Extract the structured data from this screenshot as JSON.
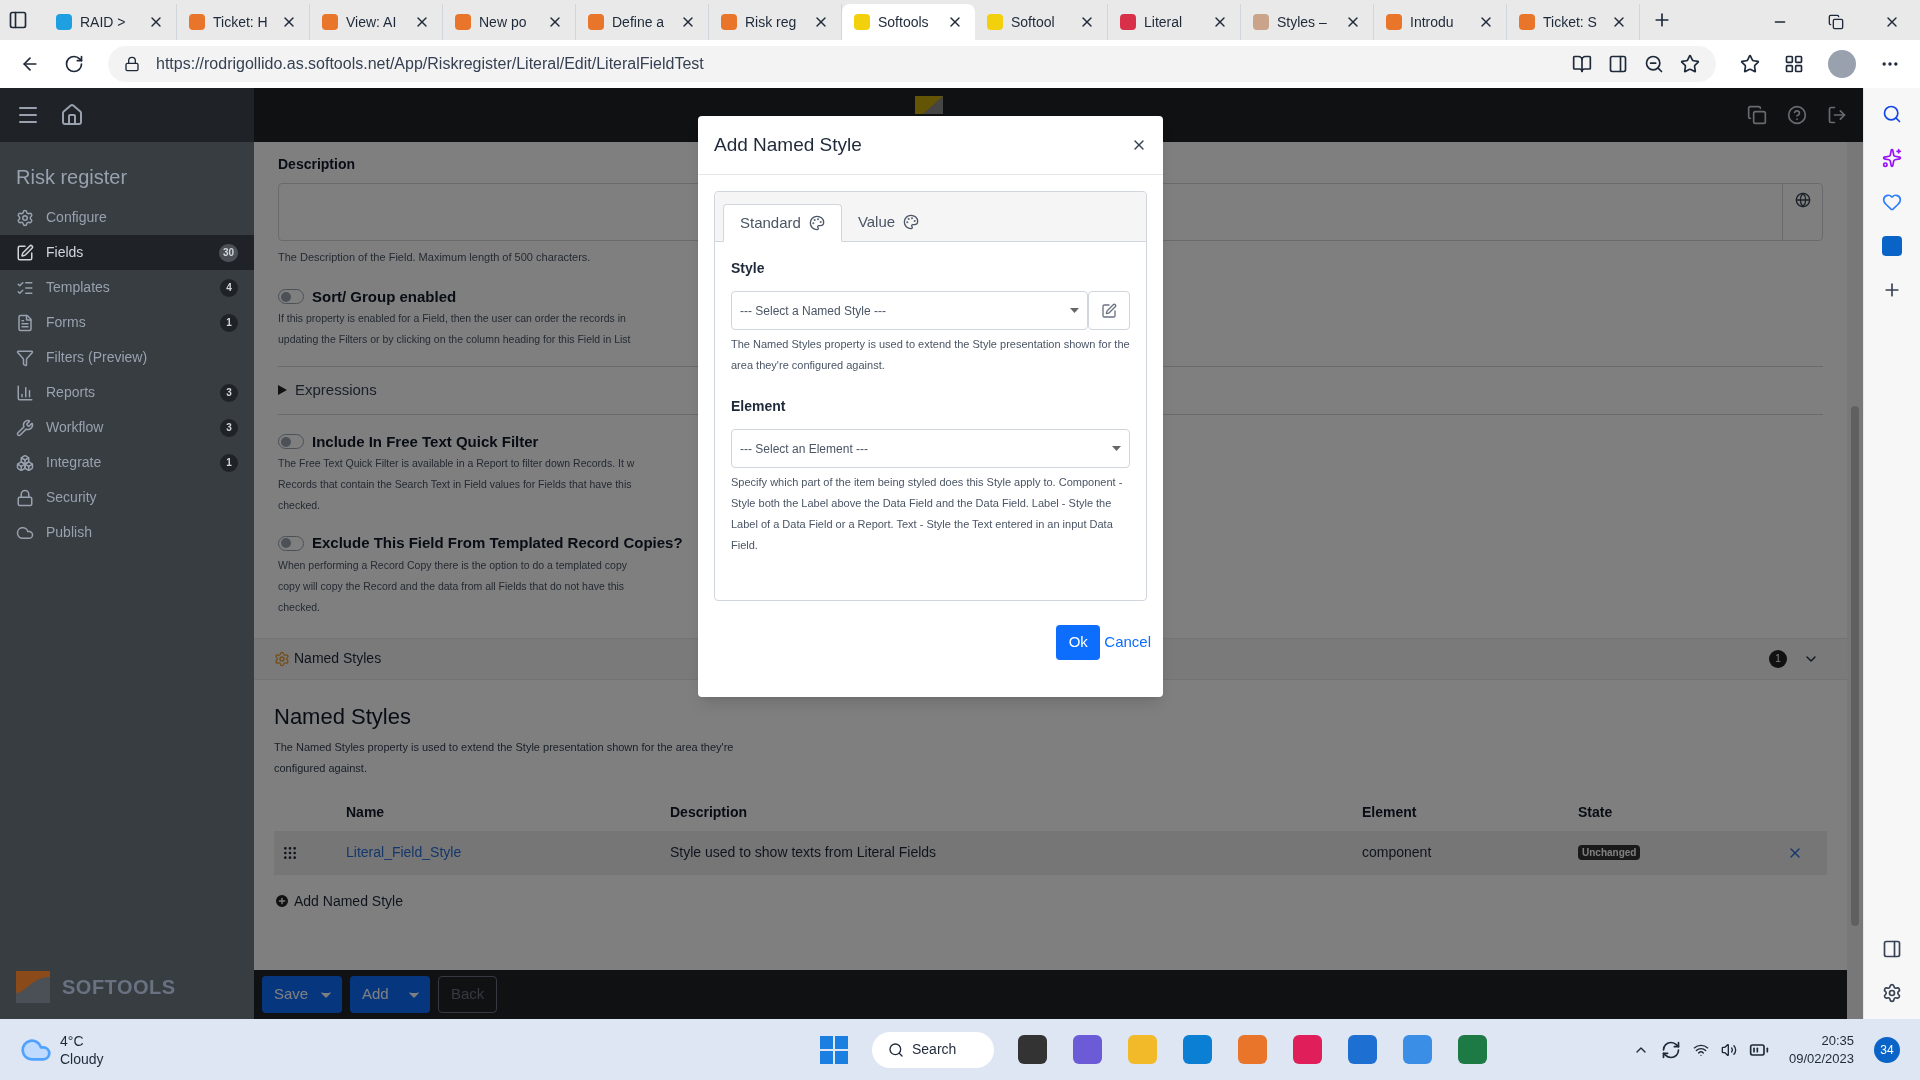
{
  "browser": {
    "tabs": [
      {
        "title": "RAID >",
        "color": "#1ea0e0",
        "selected": false
      },
      {
        "title": "Ticket: H",
        "color": "#e8752a",
        "selected": false
      },
      {
        "title": "View: AI",
        "color": "#e8752a",
        "selected": false
      },
      {
        "title": "New po",
        "color": "#e8752a",
        "selected": false
      },
      {
        "title": "Define a",
        "color": "#e8752a",
        "selected": false
      },
      {
        "title": "Risk reg",
        "color": "#e8752a",
        "selected": false
      },
      {
        "title": "Softools",
        "color": "#f2d10c",
        "selected": true
      },
      {
        "title": "Softool",
        "color": "#f2d10c",
        "selected": false
      },
      {
        "title": "Literal",
        "color": "#d9304a",
        "selected": false
      },
      {
        "title": "Styles –",
        "color": "#c9a48a",
        "selected": false
      },
      {
        "title": "Introdu",
        "color": "#e8752a",
        "selected": false
      },
      {
        "title": "Ticket: S",
        "color": "#e8752a",
        "selected": false
      }
    ],
    "address": "https://rodrigollido.as.softools.net/App/Riskregister/Literal/Edit/LiteralFieldTest"
  },
  "app": {
    "title": "Risk register",
    "brand": "SOFTOOLS",
    "nav": [
      {
        "label": "Configure",
        "selected": false
      },
      {
        "label": "Fields",
        "badge": "30",
        "selected": true
      },
      {
        "label": "Templates",
        "badge": "4",
        "selected": false
      },
      {
        "label": "Forms",
        "badge": "1",
        "selected": false
      },
      {
        "label": "Filters (Preview)",
        "selected": false
      },
      {
        "label": "Reports",
        "badge": "3",
        "selected": false
      },
      {
        "label": "Workflow",
        "badge": "3",
        "selected": false
      },
      {
        "label": "Integrate",
        "badge": "1",
        "selected": false
      },
      {
        "label": "Security",
        "selected": false
      },
      {
        "label": "Publish",
        "selected": false
      }
    ]
  },
  "form": {
    "description": {
      "label": "Description",
      "help": "The Description of the Field. Maximum length of 500 characters."
    },
    "sections": [
      {
        "kind": "toggle",
        "label": "Sort/ Group enabled",
        "on": false,
        "lines": [
          "If this property is enabled for a Field, then the user can order the records in",
          "updating the Filters or by clicking on the column heading for this Field in List"
        ]
      },
      {
        "kind": "expander",
        "label": "Expressions",
        "expanded": false
      },
      {
        "kind": "toggle",
        "label": "Include In Free Text Quick Filter",
        "on": false,
        "lines": [
          "The Free Text Quick Filter is available in a Report to filter down Records. It w",
          "Records that contain the Search Text in Field values for Fields that have this",
          "checked."
        ]
      },
      {
        "kind": "toggle",
        "label": "Exclude This Field From Templated Record Copies?",
        "on": false,
        "lines": [
          "When performing a Record Copy there is the option to do a templated copy",
          "copy will copy the Record and the data from all Fields that do not have this",
          "checked."
        ]
      }
    ],
    "named_styles_bar": {
      "label": "Named Styles",
      "count": "1"
    },
    "named_styles": {
      "title": "Named Styles",
      "help": "The Named Styles property is used to extend the Style presentation shown for the area they're configured against.",
      "columns": [
        "Name",
        "Description",
        "Element",
        "State"
      ],
      "rows": [
        {
          "name": "Literal_Field_Style",
          "description": "Style used to show texts from Literal Fields",
          "element": "component",
          "state": "Unchanged"
        }
      ],
      "add": "Add Named Style"
    },
    "actions": [
      {
        "label": "Save",
        "kind": "split",
        "disabled": false
      },
      {
        "label": "Add",
        "kind": "split",
        "disabled": false
      },
      {
        "label": "Back",
        "kind": "plain",
        "disabled": true
      }
    ]
  },
  "modal": {
    "title": "Add Named Style",
    "tabs": [
      {
        "label": "Standard",
        "selected": true
      },
      {
        "label": "Value",
        "selected": false
      }
    ],
    "fields": [
      {
        "label": "Style",
        "placeholder": "--- Select a Named Style ---",
        "edit_button": true,
        "help": "The Named Styles property is used to extend the Style presentation shown for the area they're configured against."
      },
      {
        "label": "Element",
        "placeholder": "--- Select an Element ---",
        "edit_button": false,
        "help": "Specify which part of the item being styled does this Style apply to. Component - Style both the Label above the Data Field and the Data Field. Label - Style the Label of a Data Field or a Report. Text - Style the Text entered in an input Data Field."
      }
    ],
    "ok": "Ok",
    "cancel": "Cancel"
  },
  "taskbar": {
    "temperature": "4°C",
    "weather": "Cloudy",
    "search": "Search",
    "time": "20:35",
    "date": "09/02/2023",
    "notifications": "34"
  }
}
